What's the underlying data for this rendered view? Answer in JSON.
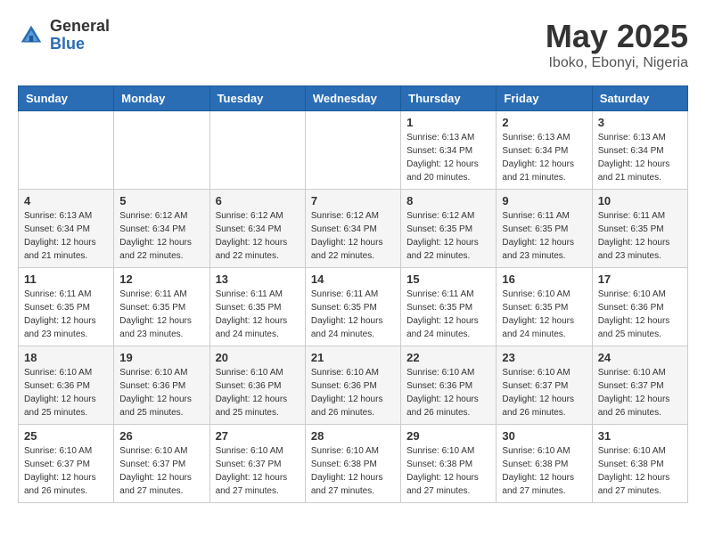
{
  "header": {
    "logo_general": "General",
    "logo_blue": "Blue",
    "month_title": "May 2025",
    "location": "Iboko, Ebonyi, Nigeria"
  },
  "days": [
    "Sunday",
    "Monday",
    "Tuesday",
    "Wednesday",
    "Thursday",
    "Friday",
    "Saturday"
  ],
  "weeks": [
    [
      {
        "date": "",
        "info": ""
      },
      {
        "date": "",
        "info": ""
      },
      {
        "date": "",
        "info": ""
      },
      {
        "date": "",
        "info": ""
      },
      {
        "date": "1",
        "info": "Sunrise: 6:13 AM\nSunset: 6:34 PM\nDaylight: 12 hours\nand 20 minutes."
      },
      {
        "date": "2",
        "info": "Sunrise: 6:13 AM\nSunset: 6:34 PM\nDaylight: 12 hours\nand 21 minutes."
      },
      {
        "date": "3",
        "info": "Sunrise: 6:13 AM\nSunset: 6:34 PM\nDaylight: 12 hours\nand 21 minutes."
      }
    ],
    [
      {
        "date": "4",
        "info": "Sunrise: 6:13 AM\nSunset: 6:34 PM\nDaylight: 12 hours\nand 21 minutes."
      },
      {
        "date": "5",
        "info": "Sunrise: 6:12 AM\nSunset: 6:34 PM\nDaylight: 12 hours\nand 22 minutes."
      },
      {
        "date": "6",
        "info": "Sunrise: 6:12 AM\nSunset: 6:34 PM\nDaylight: 12 hours\nand 22 minutes."
      },
      {
        "date": "7",
        "info": "Sunrise: 6:12 AM\nSunset: 6:34 PM\nDaylight: 12 hours\nand 22 minutes."
      },
      {
        "date": "8",
        "info": "Sunrise: 6:12 AM\nSunset: 6:35 PM\nDaylight: 12 hours\nand 22 minutes."
      },
      {
        "date": "9",
        "info": "Sunrise: 6:11 AM\nSunset: 6:35 PM\nDaylight: 12 hours\nand 23 minutes."
      },
      {
        "date": "10",
        "info": "Sunrise: 6:11 AM\nSunset: 6:35 PM\nDaylight: 12 hours\nand 23 minutes."
      }
    ],
    [
      {
        "date": "11",
        "info": "Sunrise: 6:11 AM\nSunset: 6:35 PM\nDaylight: 12 hours\nand 23 minutes."
      },
      {
        "date": "12",
        "info": "Sunrise: 6:11 AM\nSunset: 6:35 PM\nDaylight: 12 hours\nand 23 minutes."
      },
      {
        "date": "13",
        "info": "Sunrise: 6:11 AM\nSunset: 6:35 PM\nDaylight: 12 hours\nand 24 minutes."
      },
      {
        "date": "14",
        "info": "Sunrise: 6:11 AM\nSunset: 6:35 PM\nDaylight: 12 hours\nand 24 minutes."
      },
      {
        "date": "15",
        "info": "Sunrise: 6:11 AM\nSunset: 6:35 PM\nDaylight: 12 hours\nand 24 minutes."
      },
      {
        "date": "16",
        "info": "Sunrise: 6:10 AM\nSunset: 6:35 PM\nDaylight: 12 hours\nand 24 minutes."
      },
      {
        "date": "17",
        "info": "Sunrise: 6:10 AM\nSunset: 6:36 PM\nDaylight: 12 hours\nand 25 minutes."
      }
    ],
    [
      {
        "date": "18",
        "info": "Sunrise: 6:10 AM\nSunset: 6:36 PM\nDaylight: 12 hours\nand 25 minutes."
      },
      {
        "date": "19",
        "info": "Sunrise: 6:10 AM\nSunset: 6:36 PM\nDaylight: 12 hours\nand 25 minutes."
      },
      {
        "date": "20",
        "info": "Sunrise: 6:10 AM\nSunset: 6:36 PM\nDaylight: 12 hours\nand 25 minutes."
      },
      {
        "date": "21",
        "info": "Sunrise: 6:10 AM\nSunset: 6:36 PM\nDaylight: 12 hours\nand 26 minutes."
      },
      {
        "date": "22",
        "info": "Sunrise: 6:10 AM\nSunset: 6:36 PM\nDaylight: 12 hours\nand 26 minutes."
      },
      {
        "date": "23",
        "info": "Sunrise: 6:10 AM\nSunset: 6:37 PM\nDaylight: 12 hours\nand 26 minutes."
      },
      {
        "date": "24",
        "info": "Sunrise: 6:10 AM\nSunset: 6:37 PM\nDaylight: 12 hours\nand 26 minutes."
      }
    ],
    [
      {
        "date": "25",
        "info": "Sunrise: 6:10 AM\nSunset: 6:37 PM\nDaylight: 12 hours\nand 26 minutes."
      },
      {
        "date": "26",
        "info": "Sunrise: 6:10 AM\nSunset: 6:37 PM\nDaylight: 12 hours\nand 27 minutes."
      },
      {
        "date": "27",
        "info": "Sunrise: 6:10 AM\nSunset: 6:37 PM\nDaylight: 12 hours\nand 27 minutes."
      },
      {
        "date": "28",
        "info": "Sunrise: 6:10 AM\nSunset: 6:38 PM\nDaylight: 12 hours\nand 27 minutes."
      },
      {
        "date": "29",
        "info": "Sunrise: 6:10 AM\nSunset: 6:38 PM\nDaylight: 12 hours\nand 27 minutes."
      },
      {
        "date": "30",
        "info": "Sunrise: 6:10 AM\nSunset: 6:38 PM\nDaylight: 12 hours\nand 27 minutes."
      },
      {
        "date": "31",
        "info": "Sunrise: 6:10 AM\nSunset: 6:38 PM\nDaylight: 12 hours\nand 27 minutes."
      }
    ]
  ]
}
